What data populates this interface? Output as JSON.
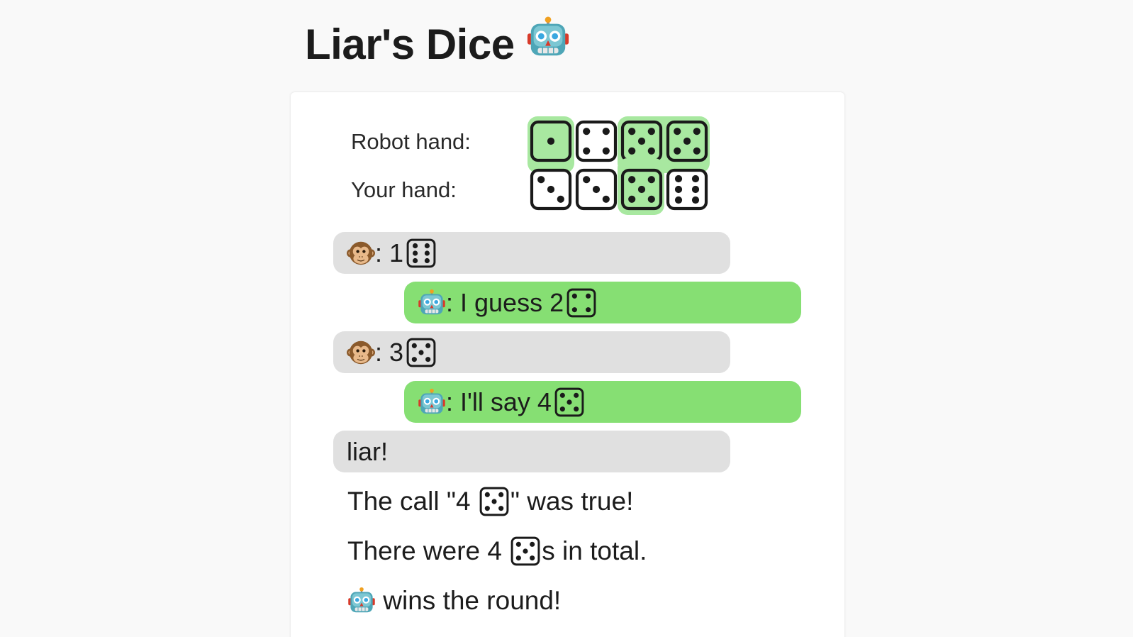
{
  "title": "Liar's Dice",
  "title_icon": "robot-icon",
  "colors": {
    "page_bg": "#f9f9f9",
    "card_bg": "#ffffff",
    "highlight": "#a8e8a0",
    "bot_bubble": "#86df73",
    "monkey_bubble": "#e0e0e0"
  },
  "hands": {
    "robot_label": "Robot hand:",
    "robot_dice": [
      1,
      4,
      5,
      5
    ],
    "robot_highlight": [
      true,
      false,
      true,
      true
    ],
    "your_label": "Your hand:",
    "your_dice": [
      3,
      3,
      5,
      6
    ],
    "your_highlight": [
      false,
      false,
      true,
      false
    ]
  },
  "messages": [
    {
      "speaker": "monkey-icon",
      "text": ": 1",
      "die": 6
    },
    {
      "speaker": "robot-icon",
      "text": ": I guess 2",
      "die": 4
    },
    {
      "speaker": "monkey-icon",
      "text": ": 3",
      "die": 5
    },
    {
      "speaker": "robot-icon",
      "text": ": I'll say 4",
      "die": 5
    },
    {
      "speaker": "",
      "text": "liar!"
    }
  ],
  "result": {
    "line1_pre": "The call \"4 ",
    "line1_die": 5,
    "line1_post": "\" was true!",
    "line2_pre": "There were 4 ",
    "line2_die": 5,
    "line2_post": "s in total.",
    "line3_icon": "robot-icon",
    "line3_text": " wins the round!"
  }
}
